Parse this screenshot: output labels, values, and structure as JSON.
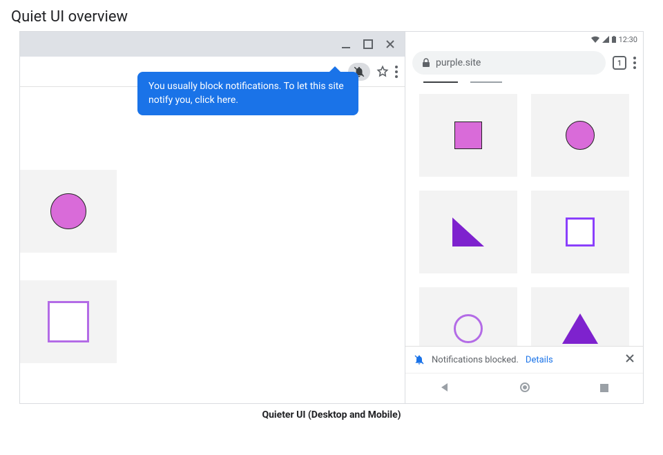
{
  "page": {
    "title": "Quiet UI overview",
    "caption": "Quieter UI (Desktop and Mobile)"
  },
  "desktop": {
    "tooltip": "You usually block notifications. To let this site notify you, click here.",
    "icons": {
      "bell_off": "bell-off-icon",
      "star": "star-icon",
      "menu": "menu-icon",
      "minimize": "minimize-icon",
      "maximize": "maximize-icon",
      "close": "close-icon"
    },
    "sidebar_shapes": [
      "circle-fill",
      "square-outline"
    ]
  },
  "mobile": {
    "status": {
      "time": "12:30"
    },
    "omnibox": {
      "site": "purple.site",
      "lock": "lock-icon"
    },
    "tab_count": "1",
    "grid_shapes": [
      "square-fill",
      "circle-fill",
      "triangle-right",
      "square-outline",
      "circle-outline",
      "triangle-eq"
    ],
    "snackbar": {
      "text": "Notifications blocked.",
      "details_label": "Details"
    },
    "nav": {
      "back": "back-icon",
      "home": "home-icon",
      "recent": "recent-icon"
    }
  },
  "colors": {
    "accent": "#1a73e8",
    "shape_fill": "#d96bd9",
    "shape_outline": "#b36be6",
    "triangle": "#7e22ce"
  }
}
